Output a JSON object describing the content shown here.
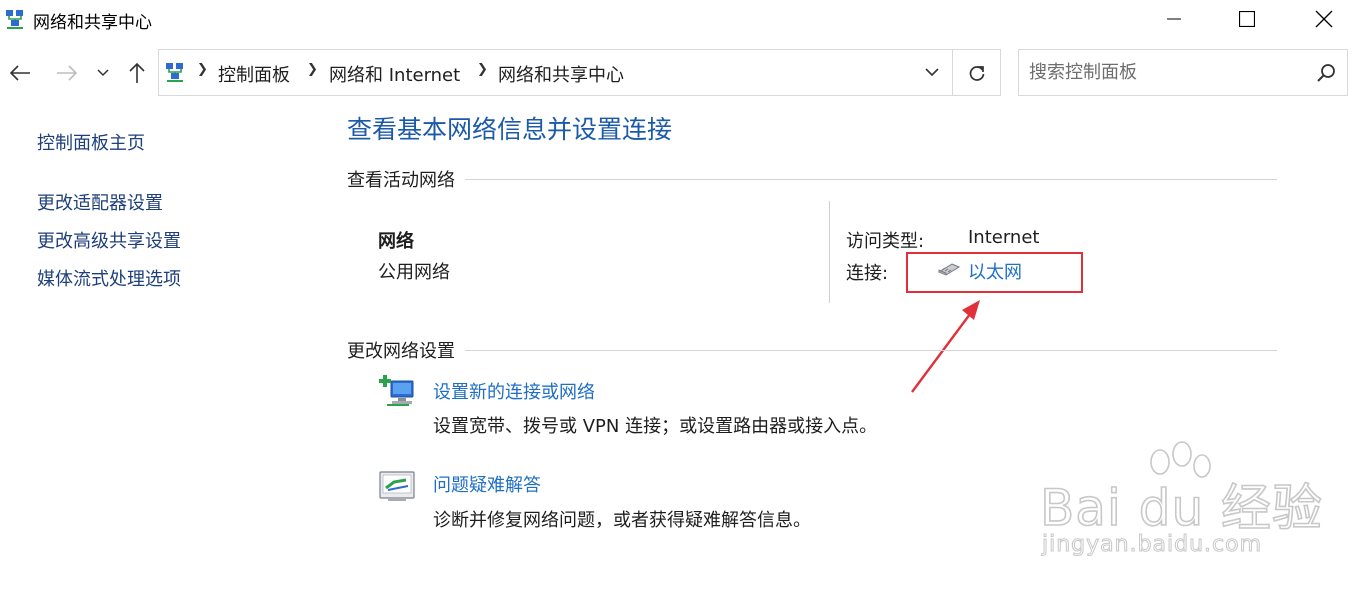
{
  "window": {
    "title": "网络和共享中心"
  },
  "address_bar": {
    "breadcrumbs": [
      "控制面板",
      "网络和 Internet",
      "网络和共享中心"
    ]
  },
  "search": {
    "placeholder": "搜索控制面板"
  },
  "left_pane": {
    "home": "控制面板主页",
    "links": [
      "更改适配器设置",
      "更改高级共享设置",
      "媒体流式处理选项"
    ]
  },
  "main": {
    "title": "查看基本网络信息并设置连接",
    "active_section": {
      "heading": "查看活动网络",
      "network_name": "网络",
      "network_type": "公用网络",
      "access_type_label": "访问类型:",
      "access_type_value": "Internet",
      "connections_label": "连接:",
      "connection_link": "以太网"
    },
    "change_section": {
      "heading": "更改网络设置",
      "tasks": [
        {
          "title": "设置新的连接或网络",
          "description": "设置宽带、拨号或 VPN 连接；或设置路由器或接入点。",
          "icon": "new-connection-icon"
        },
        {
          "title": "问题疑难解答",
          "description": "诊断并修复网络问题，或者获得疑难解答信息。",
          "icon": "troubleshoot-icon"
        }
      ]
    }
  },
  "watermark": {
    "brand": "Bai du 经验",
    "domain": "jingyan.baidu.com"
  },
  "colors": {
    "link": "#1f6fc5",
    "title": "#1c5aa8",
    "highlight": "#e0303a"
  }
}
